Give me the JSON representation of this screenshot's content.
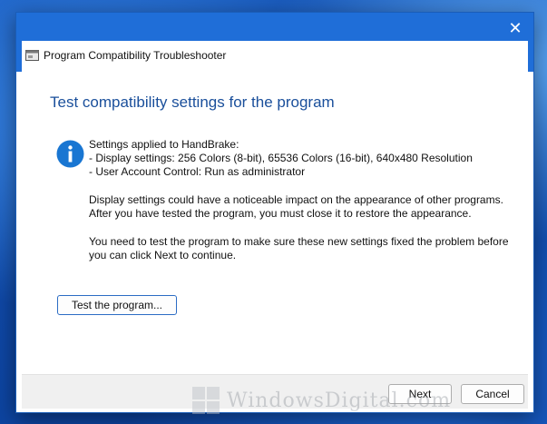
{
  "window": {
    "title": "Program Compatibility Troubleshooter",
    "close_glyph": "✕"
  },
  "content": {
    "heading": "Test compatibility settings for the program",
    "settings": {
      "line1": "Settings applied to HandBrake:",
      "line2": "- Display settings:  256 Colors (8-bit), 65536 Colors (16-bit), 640x480 Resolution",
      "line3": "- User Account Control:  Run as administrator"
    },
    "notice": {
      "line1": "Display settings could have a noticeable impact on the appearance of other programs.",
      "line2": "After you have tested the program, you must close it to restore the appearance."
    },
    "instruction": {
      "line1": "You need to test the program to make sure these new settings fixed the problem before",
      "line2": "you can click Next to continue."
    },
    "test_button_label": "Test the program...",
    "info_icon": "info-icon"
  },
  "footer": {
    "next_label": "Next",
    "cancel_label": "Cancel"
  },
  "watermark": {
    "text": "WindowsDigital.com"
  },
  "colors": {
    "titlebar": "#1f6ed8",
    "heading": "#1a4f9b",
    "info_icon": "#1976d2"
  }
}
